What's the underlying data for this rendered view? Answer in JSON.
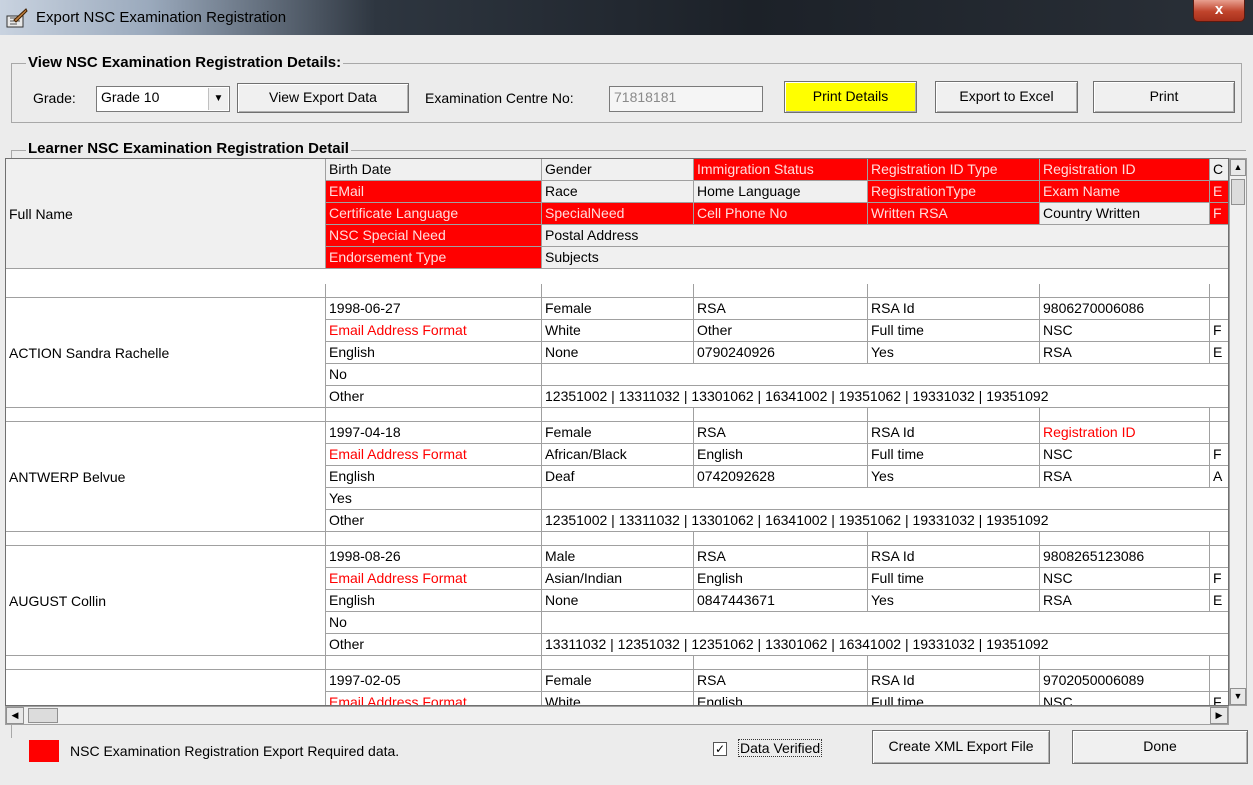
{
  "window": {
    "title": "Export NSC Examination Registration",
    "close_label": "x"
  },
  "view_group": {
    "legend": "View NSC Examination Registration Details:",
    "grade_label": "Grade:",
    "grade_value": "Grade 10",
    "view_export_button": "View Export Data",
    "centre_label": "Examination Centre No:",
    "centre_value": "71818181",
    "print_details_button": "Print Details",
    "export_excel_button": "Export to Excel",
    "print_button": "Print"
  },
  "detail_group": {
    "legend": "Learner NSC Examination Registration Detail"
  },
  "header": {
    "full_name": "Full Name",
    "rows": [
      [
        "Birth Date",
        "Gender",
        "Immigration Status",
        "Registration ID Type",
        "Registration ID",
        "C"
      ],
      [
        "EMail",
        "Race",
        "Home Language",
        "RegistrationType",
        "Exam Name",
        "E"
      ],
      [
        "Certificate Language",
        "SpecialNeed",
        "Cell Phone No",
        "Written RSA",
        "Country Written",
        "F"
      ],
      [
        "NSC Special Need",
        "Postal Address"
      ],
      [
        "Endorsement Type",
        "Subjects"
      ]
    ],
    "required": [
      [
        false,
        false,
        true,
        true,
        true,
        false
      ],
      [
        true,
        false,
        false,
        true,
        true,
        true
      ],
      [
        true,
        true,
        true,
        true,
        false,
        true
      ],
      [
        true,
        false
      ],
      [
        true,
        false
      ]
    ]
  },
  "learners": [
    {
      "name": "ACTION Sandra Rachelle",
      "rows": [
        [
          "1998-06-27",
          "Female",
          "RSA",
          "RSA Id",
          "9806270006086",
          ""
        ],
        [
          "Email Address Format",
          "White",
          "Other",
          "Full time",
          "NSC",
          "F"
        ],
        [
          "English",
          "None",
          "0790240926",
          "Yes",
          "RSA",
          "E"
        ]
      ],
      "special_need": "No",
      "endorsement": "Other",
      "subjects": "12351002 | 13311032 | 13301062 | 16341002 | 19351062 | 19331032 | 19351092"
    },
    {
      "name": "ANTWERP Belvue",
      "rows": [
        [
          "1997-04-18",
          "Female",
          "RSA",
          "RSA Id",
          "Registration ID",
          ""
        ],
        [
          "Email Address Format",
          "African/Black",
          "English",
          "Full time",
          "NSC",
          "F"
        ],
        [
          "English",
          "Deaf",
          "0742092628",
          "Yes",
          "RSA",
          "A"
        ]
      ],
      "special_need": "Yes",
      "endorsement": "Other",
      "subjects": "12351002 | 13311032 | 13301062 | 16341002 | 19351062 | 19331032 | 19351092"
    },
    {
      "name": "AUGUST Collin",
      "rows": [
        [
          "1998-08-26",
          "Male",
          "RSA",
          "RSA Id",
          "9808265123086",
          ""
        ],
        [
          "Email Address Format",
          "Asian/Indian",
          "English",
          "Full time",
          "NSC",
          "F"
        ],
        [
          "English",
          "None",
          "0847443671",
          "Yes",
          "RSA",
          "E"
        ]
      ],
      "special_need": "No",
      "endorsement": "Other",
      "subjects": "13311032 | 12351032 | 12351062 | 13301062 | 16341002 | 19331032 | 19351092"
    },
    {
      "name": "",
      "rows": [
        [
          "1997-02-05",
          "Female",
          "RSA",
          "RSA Id",
          "9702050006089",
          ""
        ],
        [
          "Email Address Format",
          "White",
          "English",
          "Full time",
          "NSC",
          "F"
        ]
      ]
    }
  ],
  "footer": {
    "legend_text": "NSC Examination Registration Export Required data.",
    "data_verified_label": "Data Verified",
    "data_verified_checked": true,
    "create_xml_button": "Create XML Export File",
    "done_button": "Done"
  },
  "colors": {
    "required": "#ff0000",
    "print_details": "#ffff00",
    "warning_text": "#ff0000"
  }
}
